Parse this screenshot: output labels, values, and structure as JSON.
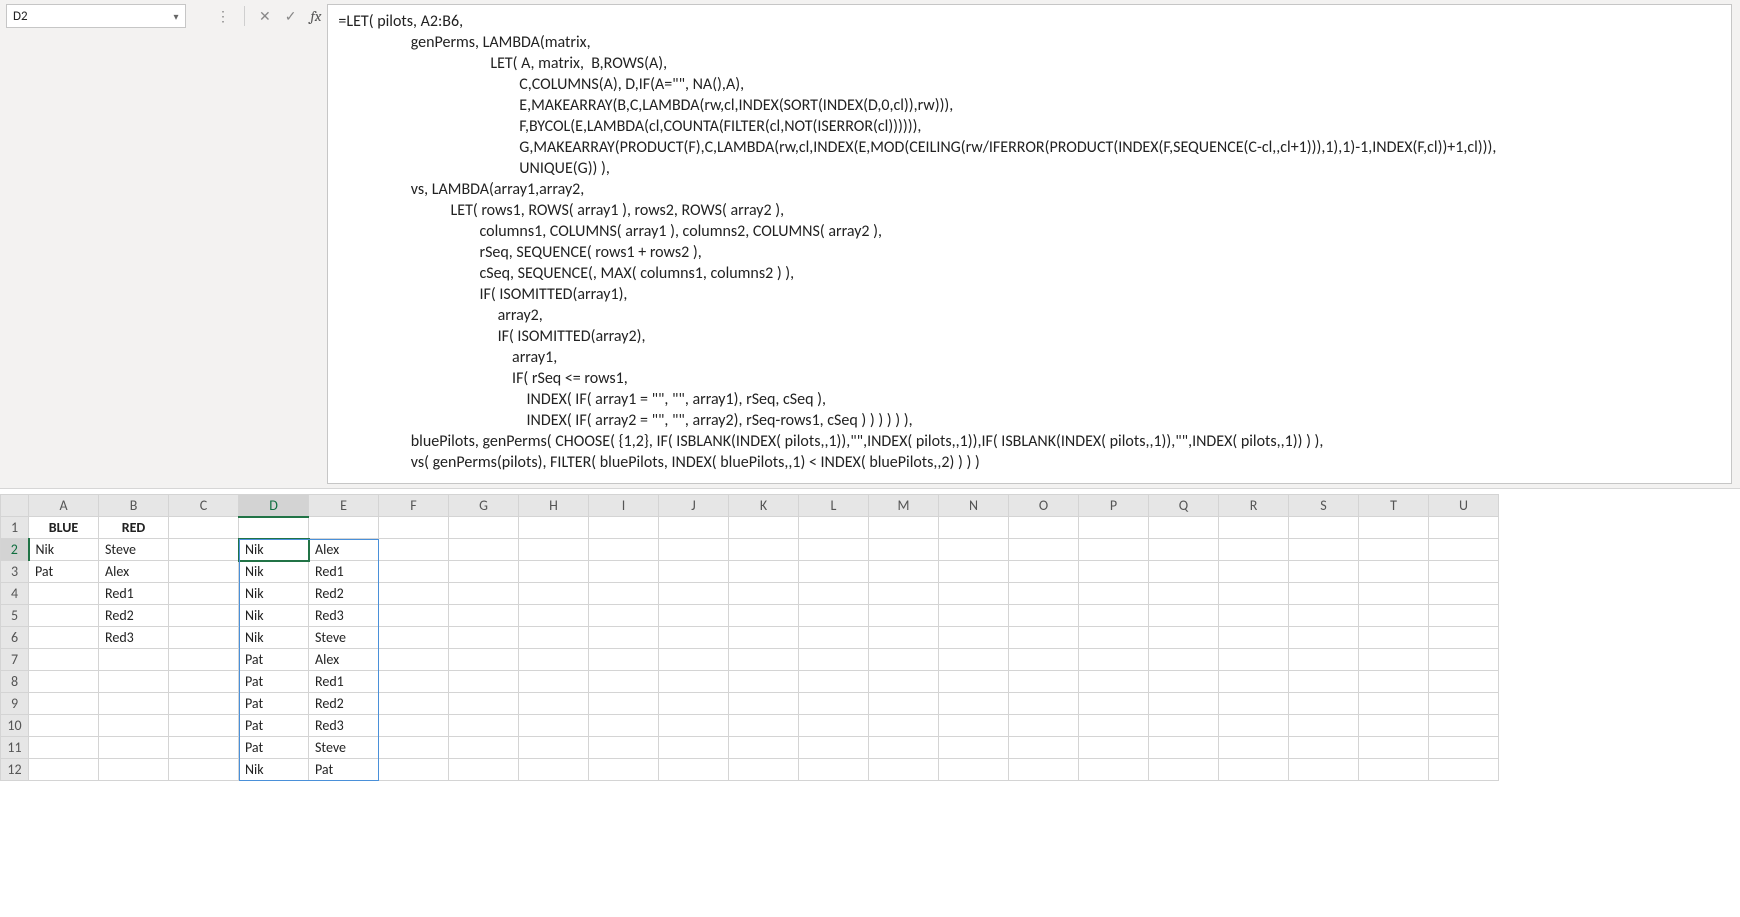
{
  "name_box": {
    "value": "D2"
  },
  "fx": {
    "cancel_icon": "✕",
    "enter_icon": "✓",
    "fx_label": "fx"
  },
  "formula": "=LET( pilots, A2:B6,\n                    genPerms, LAMBDA(matrix,\n                                          LET( A, matrix,  B,ROWS(A),\n                                                  C,COLUMNS(A), D,IF(A=\"\", NA(),A),\n                                                  E,MAKEARRAY(B,C,LAMBDA(rw,cl,INDEX(SORT(INDEX(D,0,cl)),rw))),\n                                                  F,BYCOL(E,LAMBDA(cl,COUNTA(FILTER(cl,NOT(ISERROR(cl)))))),\n                                                  G,MAKEARRAY(PRODUCT(F),C,LAMBDA(rw,cl,INDEX(E,MOD(CEILING(rw/IFERROR(PRODUCT(INDEX(F,SEQUENCE(C-cl,,cl+1))),1),1)-1,INDEX(F,cl))+1,cl))),\n                                                  UNIQUE(G)) ),\n                    vs, LAMBDA(array1,array2,\n                               LET( rows1, ROWS( array1 ), rows2, ROWS( array2 ),\n                                       columns1, COLUMNS( array1 ), columns2, COLUMNS( array2 ),\n                                       rSeq, SEQUENCE( rows1 + rows2 ),\n                                       cSeq, SEQUENCE(, MAX( columns1, columns2 ) ),\n                                       IF( ISOMITTED(array1),\n                                            array2,\n                                            IF( ISOMITTED(array2),\n                                                array1,\n                                                IF( rSeq <= rows1,\n                                                    INDEX( IF( array1 = \"\", \"\", array1), rSeq, cSeq ),\n                                                    INDEX( IF( array2 = \"\", \"\", array2), rSeq-rows1, cSeq ) ) ) ) ) ),\n                    bluePilots, genPerms( CHOOSE( {1,2}, IF( ISBLANK(INDEX( pilots,,1)),\"\",INDEX( pilots,,1)),IF( ISBLANK(INDEX( pilots,,1)),\"\",INDEX( pilots,,1)) ) ),\n                    vs( genPerms(pilots), FILTER( bluePilots, INDEX( bluePilots,,1) < INDEX( bluePilots,,2) ) ) )",
  "columns": [
    "A",
    "B",
    "C",
    "D",
    "E",
    "F",
    "G",
    "H",
    "I",
    "J",
    "K",
    "L",
    "M",
    "N",
    "O",
    "P",
    "Q",
    "R",
    "S",
    "T",
    "U"
  ],
  "rows": [
    "1",
    "2",
    "3",
    "4",
    "5",
    "6",
    "7",
    "8",
    "9",
    "10",
    "11",
    "12"
  ],
  "cells": {
    "A1": "BLUE",
    "B1": "RED",
    "A2": "Nik",
    "B2": "Steve",
    "A3": "Pat",
    "B3": "Alex",
    "B4": "Red1",
    "B5": "Red2",
    "B6": "Red3",
    "D2": "Nik",
    "E2": "Alex",
    "D3": "Nik",
    "E3": "Red1",
    "D4": "Nik",
    "E4": "Red2",
    "D5": "Nik",
    "E5": "Red3",
    "D6": "Nik",
    "E6": "Steve",
    "D7": "Pat",
    "E7": "Alex",
    "D8": "Pat",
    "E8": "Red1",
    "D9": "Pat",
    "E9": "Red2",
    "D10": "Pat",
    "E10": "Red3",
    "D11": "Pat",
    "E11": "Steve",
    "D12": "Nik",
    "E12": "Pat"
  },
  "bold_cells": [
    "A1",
    "B1"
  ],
  "active_cell": "D2",
  "spill": {
    "top_row": 2,
    "bottom_row": 12,
    "left_col": "D",
    "right_col": "E"
  }
}
